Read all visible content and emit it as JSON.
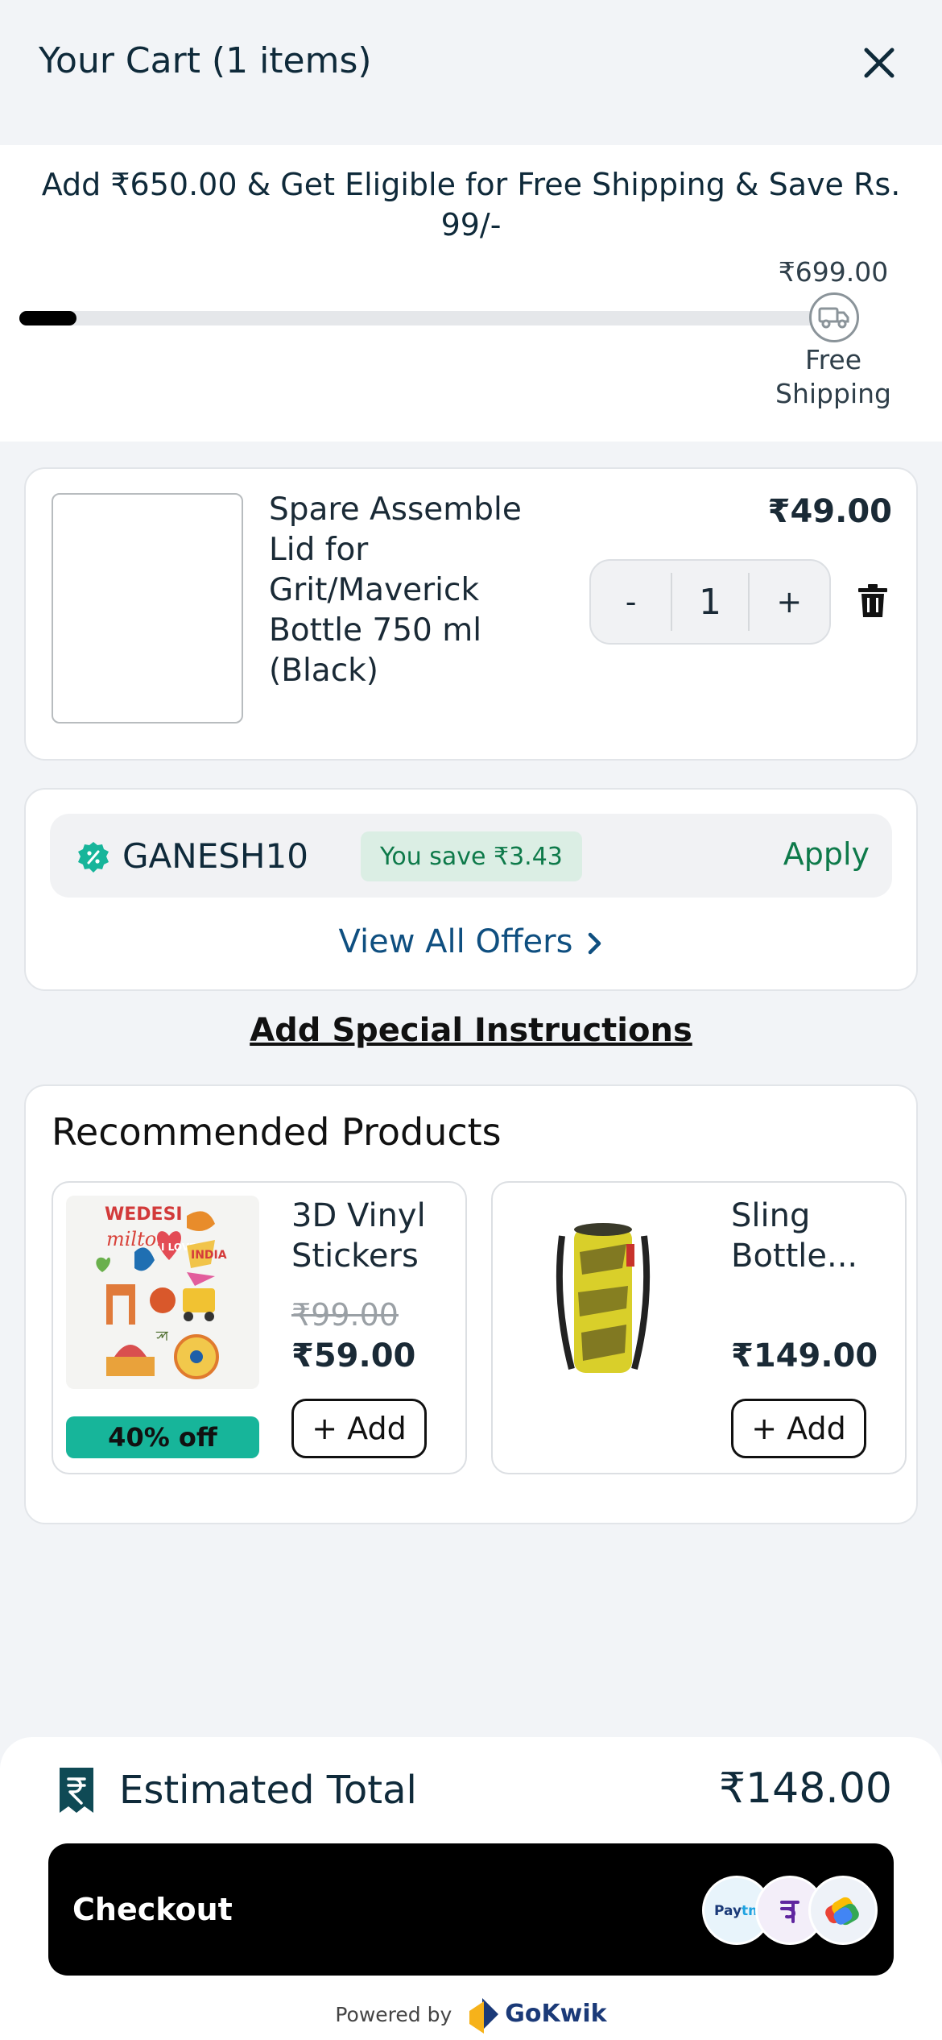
{
  "header": {
    "title": "Your Cart (1 items)"
  },
  "shipping": {
    "message": "Add ₹650.00 & Get Eligible for Free Shipping & Save Rs. 99/-",
    "threshold": "₹699.00",
    "label": "Free Shipping",
    "progress": 0.07
  },
  "cart_item": {
    "name": "Spare Assemble Lid for Grit/Maverick Bottle 750 ml (Black)",
    "price": "₹49.00",
    "quantity": "1",
    "minus": "-",
    "plus": "+"
  },
  "coupon": {
    "code": "GANESH10",
    "savings": "You save ₹3.43",
    "apply": "Apply",
    "view_all": "View All Offers"
  },
  "special_instructions": "Add Special Instructions",
  "recommended": {
    "title": "Recommended Products",
    "products": [
      {
        "name": "3D Vinyl Stickers",
        "old_price": "₹99.00",
        "price": "₹59.00",
        "add": "+ Add",
        "badge": "40% off"
      },
      {
        "name": "Sling Bottle...",
        "price": "₹149.00",
        "add": "+ Add"
      }
    ]
  },
  "footer": {
    "estimated_label": "Estimated Total",
    "estimated_total": "₹148.00",
    "checkout": "Checkout",
    "payment_icons": [
      "paytm-icon",
      "phonepe-icon",
      "gpay-icon"
    ],
    "powered_by": "Powered by",
    "brand": "GoKwik"
  },
  "colors": {
    "accent_green": "#0e7a4a",
    "link_blue": "#0f4f80",
    "badge_teal": "#17b59a"
  }
}
